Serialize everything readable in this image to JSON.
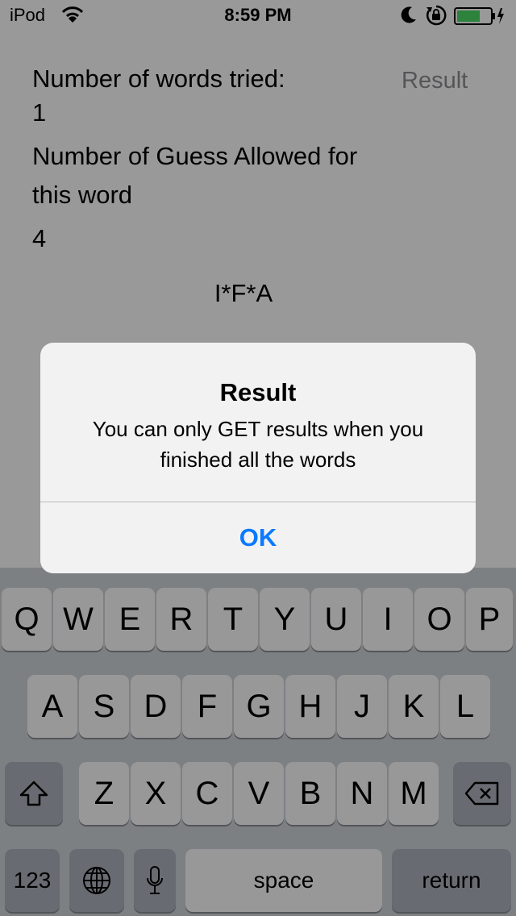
{
  "status_bar": {
    "carrier": "iPod",
    "time": "8:59 PM"
  },
  "content": {
    "words_tried_label": "Number of words tried:",
    "words_tried_value": "1",
    "guess_allowed_label": "Number of Guess Allowed for this word",
    "guess_allowed_value": "4",
    "masked_word": "I*F*A",
    "result_button": "Result"
  },
  "alert": {
    "title": "Result",
    "message": "You can only GET results when you finished all the words",
    "ok_button": "OK"
  },
  "keyboard": {
    "row1": [
      "Q",
      "W",
      "E",
      "R",
      "T",
      "Y",
      "U",
      "I",
      "O",
      "P"
    ],
    "row2": [
      "A",
      "S",
      "D",
      "F",
      "G",
      "H",
      "J",
      "K",
      "L"
    ],
    "row3": [
      "Z",
      "X",
      "C",
      "V",
      "B",
      "N",
      "M"
    ],
    "numbers_key": "123",
    "space_key": "space",
    "return_key": "return",
    "shift_icon": "shift-icon",
    "delete_icon": "delete-icon",
    "globe_icon": "globe-icon",
    "mic_icon": "microphone-icon"
  },
  "colors": {
    "alert_button": "#0a7aff",
    "battery_fill": "#4cd964",
    "result_link": "#8e8e93",
    "dim_overlay": "rgba(0,0,0,0.40)"
  }
}
